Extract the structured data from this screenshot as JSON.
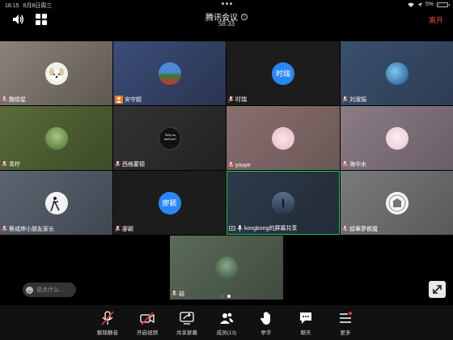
{
  "status_bar": {
    "time": "16:15",
    "date": "6月8日周三",
    "battery": "5%"
  },
  "header": {
    "title": "腾讯会议",
    "info_glyph": "i",
    "timer": "58:33",
    "leave_label": "离开"
  },
  "participants": [
    {
      "name": "魏煜星",
      "avatar": "dog-photo"
    },
    {
      "name": "安守超",
      "avatar": "landscape-photo",
      "badge": "host-icon"
    },
    {
      "name": "时瑞",
      "avatar_text": "时瑞",
      "avatar": "text-avatar"
    },
    {
      "name": "刘淑娟",
      "avatar": "globe-photo"
    },
    {
      "name": "青柠",
      "avatar": "tree-photo"
    },
    {
      "name": "西格蒙德",
      "avatar": "sign-photo",
      "avatar_caption": "Why so serious?"
    },
    {
      "name": "youye",
      "avatar": "cartoon-photo"
    },
    {
      "name": "海中水",
      "avatar": "anime-girl-photo"
    },
    {
      "name": "蔡成烨小朋友家长",
      "avatar": "silhouette-photo"
    },
    {
      "name": "廖颖",
      "avatar_text": "廖颖",
      "avatar": "text-avatar"
    },
    {
      "name": "kongkong的屏幕共享",
      "avatar": "beach-photo",
      "badge": "screen-share-icon"
    },
    {
      "name": "録華夢都魔",
      "avatar": "building-photo"
    },
    {
      "name": "喆",
      "avatar": "forest-photo"
    }
  ],
  "chat_input": {
    "placeholder": "说点什么..."
  },
  "toolbar": [
    {
      "label": "解除静音",
      "icon": "mic-muted-icon"
    },
    {
      "label": "开启视频",
      "icon": "camera-off-icon"
    },
    {
      "label": "共享屏幕",
      "icon": "share-screen-icon"
    },
    {
      "label": "成员(13)",
      "icon": "members-icon"
    },
    {
      "label": "举手",
      "icon": "raise-hand-icon"
    },
    {
      "label": "聊天",
      "icon": "chat-icon"
    },
    {
      "label": "更多",
      "icon": "more-icon"
    }
  ],
  "colors": {
    "leave": "#f04b3e",
    "active_speaker_border": "#1fc35a",
    "text_avatar_bg": "#2a86f6",
    "toolbar_bg": "#111111"
  }
}
